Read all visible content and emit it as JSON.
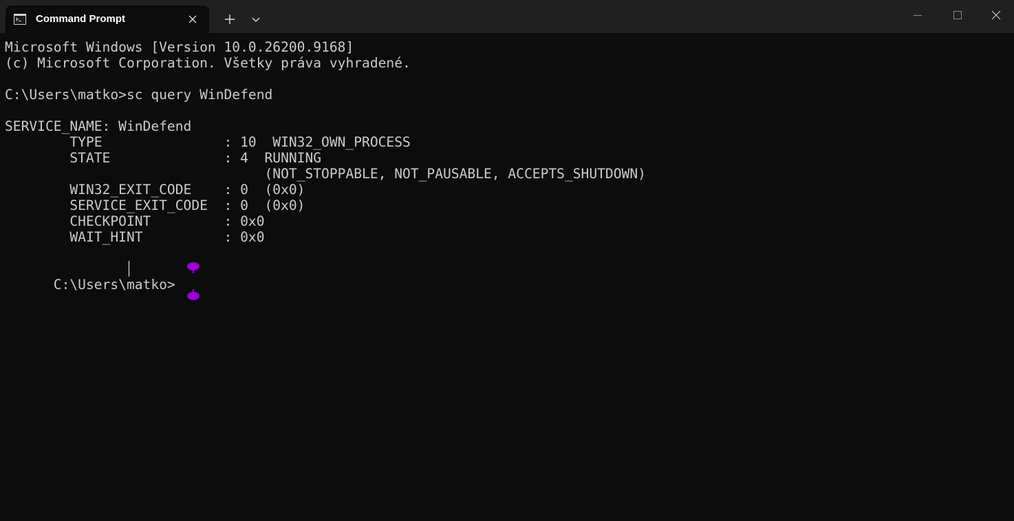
{
  "window": {
    "tab_title": "Command Prompt",
    "tab_icon": "terminal-icon",
    "new_tab_icon": "plus-icon",
    "dropdown_icon": "chevron-down-icon",
    "minimize_icon": "minimize-icon",
    "maximize_icon": "maximize-icon",
    "close_icon": "close-icon"
  },
  "colors": {
    "terminal_background": "#0c0c0c",
    "titlebar_background": "#202020",
    "text": "#cccccc",
    "selection_handle": "#9b00d4"
  },
  "terminal": {
    "lines": [
      "Microsoft Windows [Version 10.0.26200.9168]",
      "(c) Microsoft Corporation. Všetky práva vyhradené.",
      "",
      "C:\\Users\\matko>sc query WinDefend",
      "",
      "SERVICE_NAME: WinDefend",
      "        TYPE               : 10  WIN32_OWN_PROCESS",
      "        STATE              : 4  RUNNING",
      "                                (NOT_STOPPABLE, NOT_PAUSABLE, ACCEPTS_SHUTDOWN)",
      "        WIN32_EXIT_CODE    : 0  (0x0)",
      "        SERVICE_EXIT_CODE  : 0  (0x0)",
      "        CHECKPOINT         : 0x0",
      "        WAIT_HINT          : 0x0",
      ""
    ],
    "prompt": "C:\\Users\\matko>"
  }
}
